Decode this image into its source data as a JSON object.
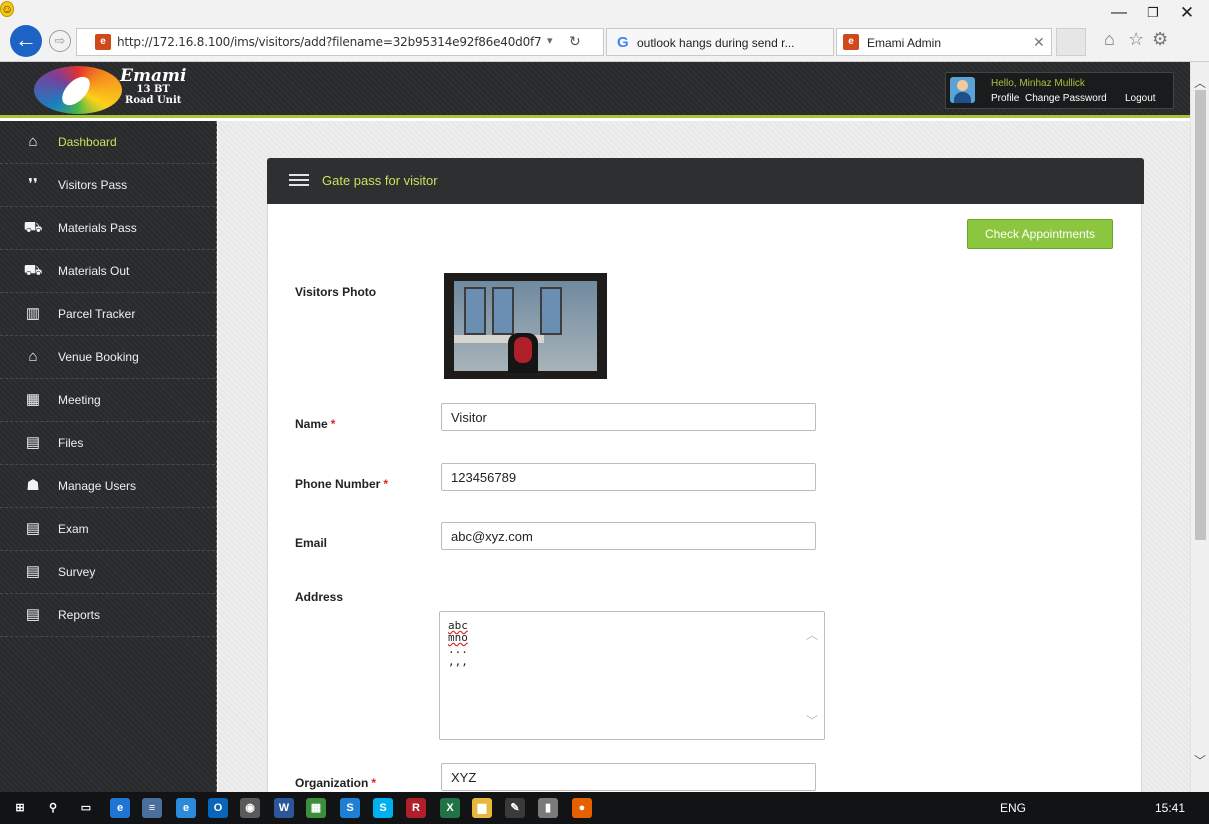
{
  "window": {
    "minimize": "—",
    "restore": "❐",
    "close": "✕"
  },
  "browser": {
    "back_icon": "←",
    "forward_icon": "⇨",
    "address_url": "http://172.16.8.100/ims/visitors/add?filename=32b95314e92f86e40d0f7",
    "address_dropdown": "▾",
    "address_refresh": "↻",
    "tabs": [
      {
        "label": "outlook hangs during send r...",
        "favicon": "G"
      },
      {
        "label": "Emami Admin",
        "favicon": "e",
        "close": "✕"
      }
    ],
    "toolbar_icons": {
      "home": "⌂",
      "favorites": "☆",
      "settings": "⚙",
      "smiley": "☺"
    }
  },
  "header": {
    "logo": {
      "name": "Emami",
      "unit_line1": "13 BT",
      "unit_line2": "Road Unit"
    },
    "greeting": "Hello, Minhaz Mullick",
    "links": {
      "profile": "Profile",
      "change_password": "Change Password",
      "logout": "Logout"
    }
  },
  "sidebar": {
    "items": [
      {
        "label": "Dashboard",
        "icon": "home-icon",
        "glyph": "⌂"
      },
      {
        "label": "Visitors Pass",
        "icon": "footprints-icon",
        "glyph": "❜❜"
      },
      {
        "label": "Materials Pass",
        "icon": "truck-icon",
        "glyph": "⛟"
      },
      {
        "label": "Materials Out",
        "icon": "truck-icon",
        "glyph": "⛟"
      },
      {
        "label": "Parcel Tracker",
        "icon": "parcel-icon",
        "glyph": "▥"
      },
      {
        "label": "Venue Booking",
        "icon": "building-icon",
        "glyph": "⌂"
      },
      {
        "label": "Meeting",
        "icon": "calendar-icon",
        "glyph": "▦"
      },
      {
        "label": "Files",
        "icon": "files-icon",
        "glyph": "▤"
      },
      {
        "label": "Manage Users",
        "icon": "users-icon",
        "glyph": "☗"
      },
      {
        "label": "Exam",
        "icon": "document-icon",
        "glyph": "▤"
      },
      {
        "label": "Survey",
        "icon": "document-icon",
        "glyph": "▤"
      },
      {
        "label": "Reports",
        "icon": "clipboard-icon",
        "glyph": "▤"
      }
    ],
    "active": "Dashboard",
    "colors": {
      "active_label": "#c7e35a",
      "accent": "#a6c33a"
    }
  },
  "form": {
    "title": "Gate pass for visitor",
    "check_appointments": "Check Appointments",
    "labels": {
      "photo": "Visitors Photo",
      "name": "Name",
      "phone": "Phone Number",
      "email": "Email",
      "address": "Address",
      "organization": "Organization"
    },
    "required_marker": "*",
    "values": {
      "name": "Visitor",
      "phone": "123456789",
      "email": "abc@xyz.com",
      "address_lines": [
        "abc",
        "mno",
        "...",
        ",,,"
      ],
      "organization": "XYZ"
    },
    "scroll_up": "︿",
    "scroll_down": "﹀"
  },
  "scrollbar": {
    "up": "︿",
    "down": "﹀"
  },
  "taskbar": {
    "apps": [
      {
        "name": "windows-start",
        "glyph": "⊞",
        "color": "#111315"
      },
      {
        "name": "search",
        "glyph": "⚲",
        "color": "#111315"
      },
      {
        "name": "task-view",
        "glyph": "▭",
        "color": "#111315"
      },
      {
        "name": "edge",
        "glyph": "e",
        "color": "#1f76d2"
      },
      {
        "name": "notepad",
        "glyph": "≡",
        "color": "#4a6f9a"
      },
      {
        "name": "internet-explorer",
        "glyph": "e",
        "color": "#2c8ad8"
      },
      {
        "name": "outlook",
        "glyph": "O",
        "color": "#0a64b7"
      },
      {
        "name": "camera",
        "glyph": "◉",
        "color": "#5a5a5a"
      },
      {
        "name": "word",
        "glyph": "W",
        "color": "#2b579a"
      },
      {
        "name": "files",
        "glyph": "▦",
        "color": "#3b8f3b"
      },
      {
        "name": "skype-business",
        "glyph": "S",
        "color": "#1f7fd3"
      },
      {
        "name": "skype",
        "glyph": "S",
        "color": "#00aff0"
      },
      {
        "name": "app-r",
        "glyph": "R",
        "color": "#b01f2a"
      },
      {
        "name": "excel",
        "glyph": "X",
        "color": "#217346"
      },
      {
        "name": "explorer",
        "glyph": "▆",
        "color": "#e8b83a"
      },
      {
        "name": "paint",
        "glyph": "✎",
        "color": "#3a3a3a"
      },
      {
        "name": "calculator",
        "glyph": "▮",
        "color": "#7a7a7a"
      },
      {
        "name": "firefox",
        "glyph": "●",
        "color": "#e66000"
      }
    ],
    "tray": "ENG",
    "clock": "15:41"
  }
}
